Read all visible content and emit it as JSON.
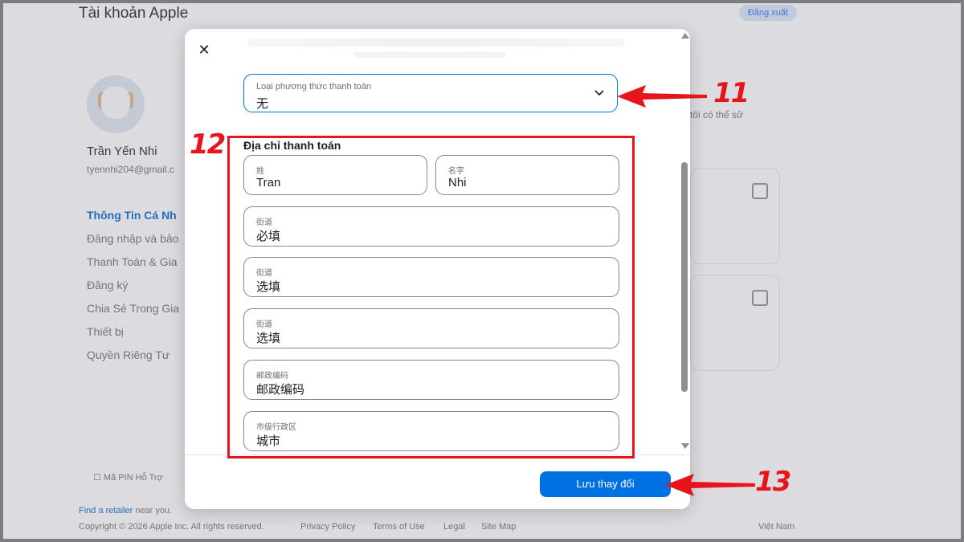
{
  "background": {
    "title": "Tài khoản Apple",
    "logout": "Đăng xuất",
    "user_name": "Trần Yến Nhi",
    "user_email": "tyennhi204@gmail.c",
    "menu": [
      {
        "label": "Thông Tin Cá Nh",
        "active": true
      },
      {
        "label": "Đăng nhập và bảo",
        "active": false
      },
      {
        "label": "Thanh Toán & Gia",
        "active": false
      },
      {
        "label": "Đăng ký",
        "active": false
      },
      {
        "label": "Chia Sẻ Trong Gia",
        "active": false
      },
      {
        "label": "Thiết bị",
        "active": false
      },
      {
        "label": "Quyền Riêng Tư",
        "active": false
      }
    ],
    "side_text": "g tôi có thể sử",
    "pin": "Mã PIN Hỗ Trợ",
    "find_retailer_link": "Find a retailer",
    "find_retailer_rest": " near you.",
    "copyright": "Copyright © 2026 Apple Inc. All rights reserved.",
    "footer_links": [
      "Privacy Policy",
      "Terms of Use",
      "Legal",
      "Site Map"
    ],
    "country": "Việt Nam"
  },
  "modal": {
    "payment_method": {
      "label": "Loại phương thức thanh toán",
      "value": "无"
    },
    "billing_title": "Địa chỉ thanh toán",
    "last_name": {
      "label": "姓",
      "value": "Tran"
    },
    "first_name": {
      "label": "名字",
      "value": "Nhi"
    },
    "street1": {
      "label": "街道",
      "value": "必填"
    },
    "street2": {
      "label": "街道",
      "value": "选填"
    },
    "street3": {
      "label": "街道",
      "value": "选填"
    },
    "postal": {
      "label": "邮政编码",
      "value": "邮政编码"
    },
    "city": {
      "label": "市级行政区",
      "value": "城市"
    },
    "save_label": "Lưu thay đổi",
    "close_glyph": "✕"
  },
  "annotations": {
    "n11": "11",
    "n12": "12",
    "n13": "13"
  },
  "colors": {
    "accent": "#0071e3",
    "annotation": "#e8141c"
  }
}
